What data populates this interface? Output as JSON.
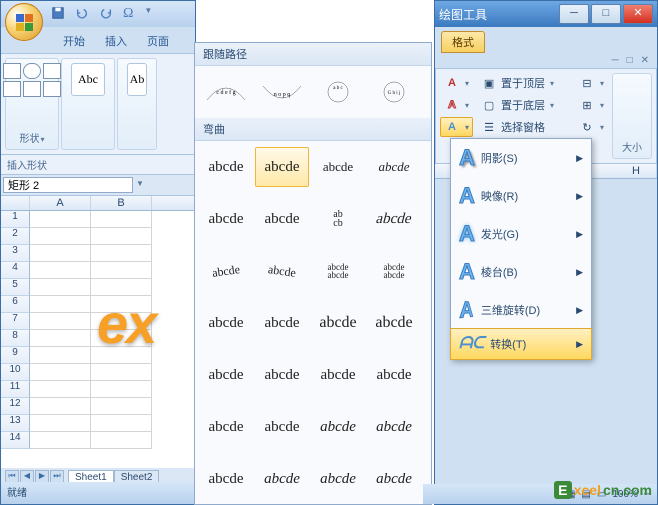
{
  "left": {
    "tabs": {
      "start": "开始",
      "insert": "插入",
      "page": "页面"
    },
    "ribbon": {
      "shapes_label": "形状",
      "abc": "Abc",
      "abc2": "Ab",
      "group": "插入形状"
    },
    "namebox": "矩形 2",
    "cols": {
      "a": "A",
      "b": "B"
    },
    "wordart": "ex",
    "sheets": {
      "s1": "Sheet1",
      "s2": "Sheet2"
    },
    "status": "就绪"
  },
  "gallery": {
    "hdr1": "跟随路径",
    "hdr2": "弯曲",
    "sample": "abcde"
  },
  "right": {
    "title": "绘图工具",
    "tab": "格式",
    "arrange": {
      "top": "置于顶层",
      "bottom": "置于底层",
      "select": "选择窗格"
    },
    "size_label": "大小",
    "colhdr": "H",
    "zoom": "100%"
  },
  "fx": {
    "shadow": "阴影(S)",
    "reflect": "映像(R)",
    "glow": "发光(G)",
    "bevel": "棱台(B)",
    "rot3d": "三维旋转(D)",
    "transform": "转换(T)"
  },
  "watermark": {
    "e": "E",
    "t1": "xcel",
    "t2": "cn.com"
  }
}
